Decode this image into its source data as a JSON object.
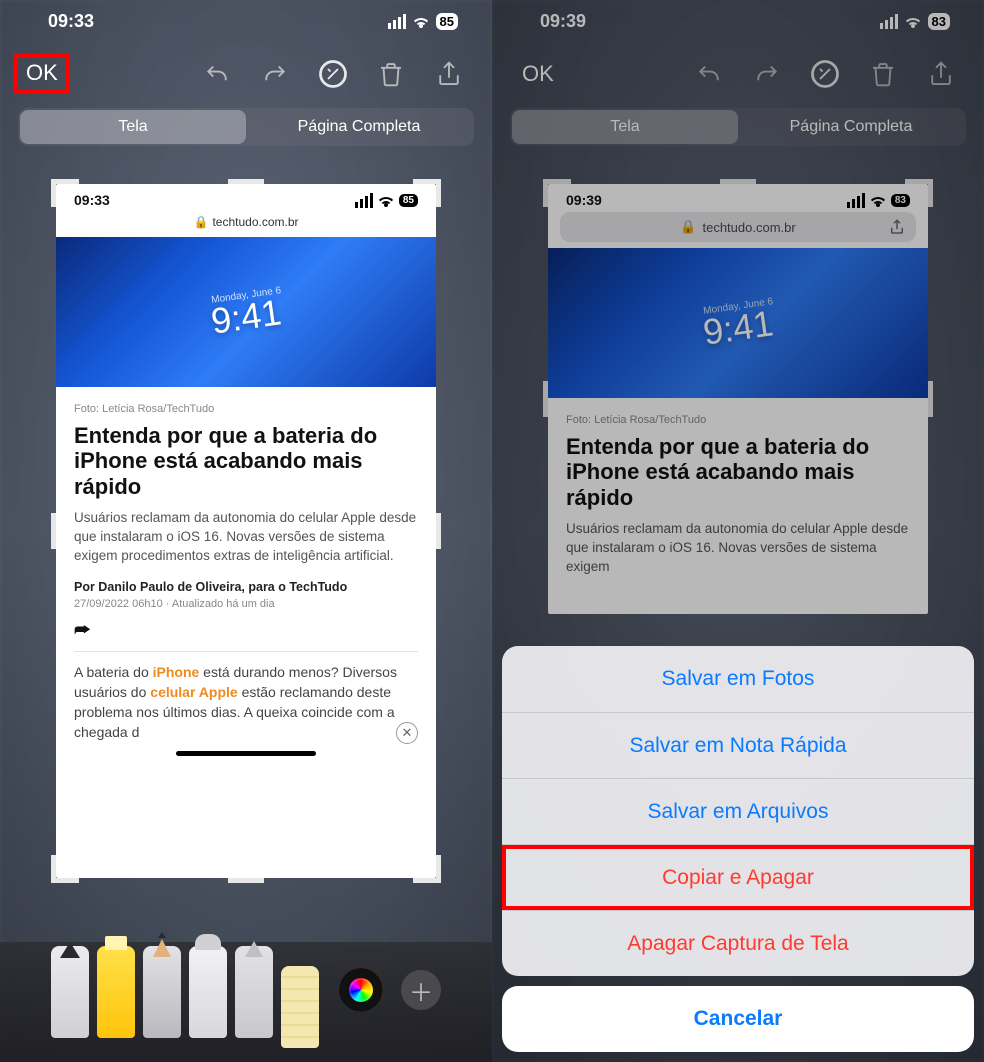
{
  "left": {
    "status": {
      "time": "09:33",
      "battery": "85"
    },
    "toolbar": {
      "ok": "OK"
    },
    "segmented": {
      "screen": "Tela",
      "full": "Página Completa"
    },
    "preview": {
      "status_time": "09:33",
      "status_battery": "85",
      "url": "techtudo.com.br",
      "caption": "Foto: Letícia Rosa/TechTudo",
      "headline": "Entenda por que a bateria do iPhone está acabando mais rápido",
      "lead": "Usuários reclamam da autonomia do celular Apple desde que instalaram o iOS 16. Novas versões de sistema exigem procedimentos extras de inteligência artificial.",
      "byline": "Por Danilo Paulo de Oliveira, para o TechTudo",
      "dateline": "27/09/2022 06h10 · Atualizado há um dia",
      "hero_date": "Monday, June 6",
      "hero_clock": "9:41",
      "body_part1": "A bateria do ",
      "body_kw1": "iPhone",
      "body_part2": " está durando menos? Diversos usuários do ",
      "body_kw2": "celular Apple",
      "body_part3": " estão reclamando deste problema nos últimos dias. A queixa coincide com a chegada d"
    }
  },
  "right": {
    "status": {
      "time": "09:39",
      "battery": "83"
    },
    "toolbar": {
      "ok": "OK"
    },
    "segmented": {
      "screen": "Tela",
      "full": "Página Completa"
    },
    "preview": {
      "status_time": "09:39",
      "status_battery": "83",
      "url": "techtudo.com.br",
      "caption": "Foto: Letícia Rosa/TechTudo",
      "headline": "Entenda por que a bateria do iPhone está acabando mais rápido",
      "lead": "Usuários reclamam da autonomia do celular Apple desde que instalaram o iOS 16. Novas versões de sistema exigem",
      "hero_date": "Monday, June 6",
      "hero_clock": "9:41"
    },
    "sheet": {
      "save_photos": "Salvar em Fotos",
      "save_quick_note": "Salvar em Nota Rápida",
      "save_files": "Salvar em Arquivos",
      "copy_delete": "Copiar e Apagar",
      "delete_screenshot": "Apagar Captura de Tela",
      "cancel": "Cancelar"
    }
  },
  "tools": [
    "pen",
    "highlighter",
    "pencil",
    "eraser",
    "lasso",
    "ruler"
  ]
}
